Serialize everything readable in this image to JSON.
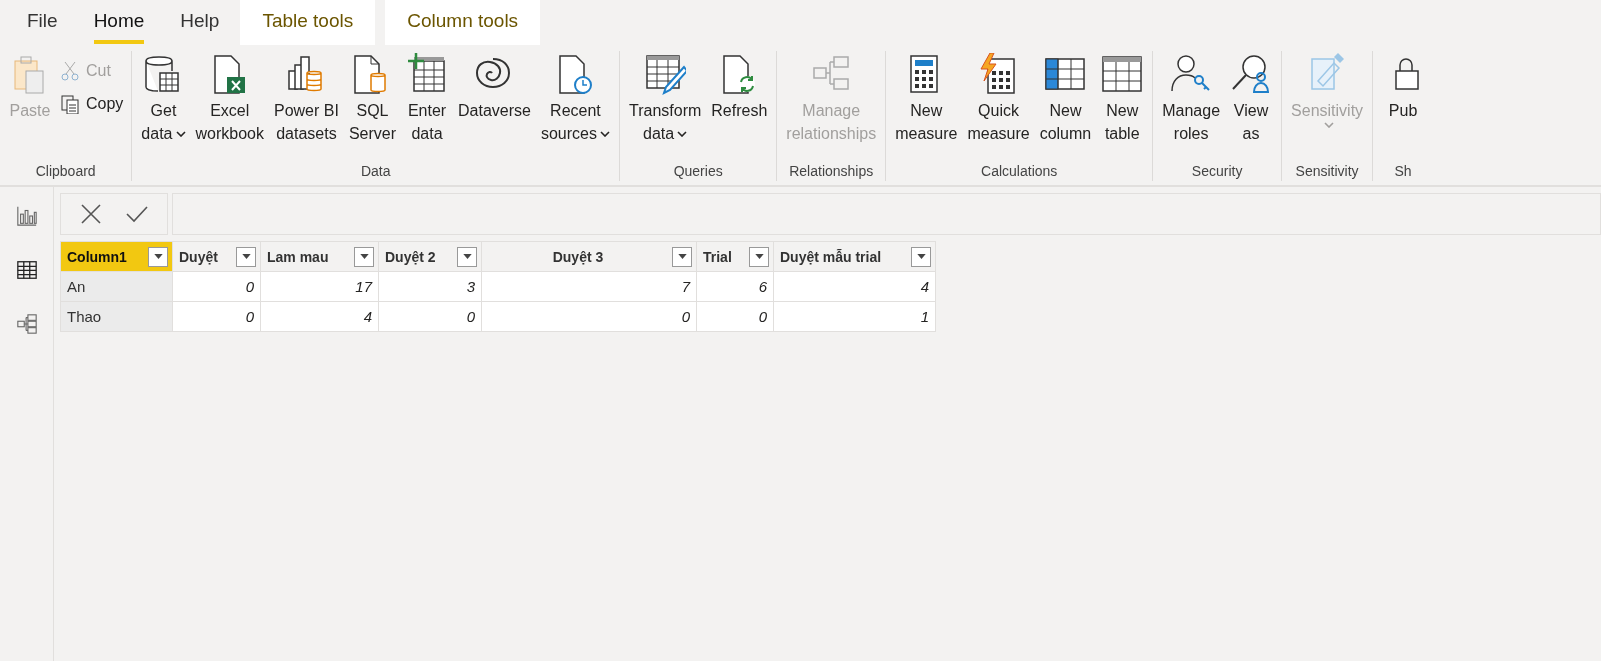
{
  "menu_tabs": [
    {
      "label": "File",
      "selected": false,
      "kind": "plain"
    },
    {
      "label": "Home",
      "selected": true,
      "kind": "plain"
    },
    {
      "label": "Help",
      "selected": false,
      "kind": "plain"
    },
    {
      "label": "Table tools",
      "selected": false,
      "kind": "contextual"
    },
    {
      "label": "Column tools",
      "selected": false,
      "kind": "contextual"
    }
  ],
  "ribbon_groups": [
    {
      "label": "Clipboard",
      "buttons": [
        {
          "kind": "large",
          "lines": [
            "Paste"
          ],
          "disabled": true,
          "dropdown": false
        },
        {
          "kind": "small",
          "lines": [
            "Cut"
          ],
          "disabled": true,
          "dropdown": false
        },
        {
          "kind": "small",
          "lines": [
            "Copy"
          ],
          "disabled": false,
          "dropdown": false
        }
      ]
    },
    {
      "label": "Data",
      "buttons": [
        {
          "kind": "large",
          "lines": [
            "Get",
            "data"
          ],
          "disabled": false,
          "dropdown": true
        },
        {
          "kind": "large",
          "lines": [
            "Excel",
            "workbook"
          ],
          "disabled": false,
          "dropdown": false
        },
        {
          "kind": "large",
          "lines": [
            "Power BI",
            "datasets"
          ],
          "disabled": false,
          "dropdown": false
        },
        {
          "kind": "large",
          "lines": [
            "SQL",
            "Server"
          ],
          "disabled": false,
          "dropdown": false
        },
        {
          "kind": "large",
          "lines": [
            "Enter",
            "data"
          ],
          "disabled": false,
          "dropdown": false
        },
        {
          "kind": "large",
          "lines": [
            "Dataverse"
          ],
          "disabled": false,
          "dropdown": false
        },
        {
          "kind": "large",
          "lines": [
            "Recent",
            "sources"
          ],
          "disabled": false,
          "dropdown": true
        }
      ]
    },
    {
      "label": "Queries",
      "buttons": [
        {
          "kind": "large",
          "lines": [
            "Transform",
            "data"
          ],
          "disabled": false,
          "dropdown": true
        },
        {
          "kind": "large",
          "lines": [
            "Refresh"
          ],
          "disabled": false,
          "dropdown": false
        }
      ]
    },
    {
      "label": "Relationships",
      "buttons": [
        {
          "kind": "large",
          "lines": [
            "Manage",
            "relationships"
          ],
          "disabled": true,
          "dropdown": false
        }
      ]
    },
    {
      "label": "Calculations",
      "buttons": [
        {
          "kind": "large",
          "lines": [
            "New",
            "measure"
          ],
          "disabled": false,
          "dropdown": false
        },
        {
          "kind": "large",
          "lines": [
            "Quick",
            "measure"
          ],
          "disabled": false,
          "dropdown": false
        },
        {
          "kind": "large",
          "lines": [
            "New",
            "column"
          ],
          "disabled": false,
          "dropdown": false
        },
        {
          "kind": "large",
          "lines": [
            "New",
            "table"
          ],
          "disabled": false,
          "dropdown": false
        }
      ]
    },
    {
      "label": "Security",
      "buttons": [
        {
          "kind": "large",
          "lines": [
            "Manage",
            "roles"
          ],
          "disabled": false,
          "dropdown": false
        },
        {
          "kind": "large",
          "lines": [
            "View",
            "as"
          ],
          "disabled": false,
          "dropdown": false
        }
      ]
    },
    {
      "label": "Sensitivity",
      "buttons": [
        {
          "kind": "large",
          "lines": [
            "Sensitivity"
          ],
          "disabled": true,
          "dropdown": true
        }
      ]
    },
    {
      "label": "Sh",
      "buttons": [
        {
          "kind": "large",
          "lines": [
            "Pub"
          ],
          "disabled": false,
          "dropdown": false
        }
      ]
    }
  ],
  "table": {
    "columns": [
      {
        "label": "Column1",
        "selected": true,
        "kind": "text"
      },
      {
        "label": "Duyệt",
        "selected": false,
        "kind": "number"
      },
      {
        "label": "Lam mau",
        "selected": false,
        "kind": "number"
      },
      {
        "label": "Duyệt 2",
        "selected": false,
        "kind": "number"
      },
      {
        "label": "Duyệt 3",
        "selected": false,
        "kind": "number"
      },
      {
        "label": "Trial",
        "selected": false,
        "kind": "number"
      },
      {
        "label": "Duyệt mẫu trial",
        "selected": false,
        "kind": "number"
      }
    ],
    "rows": [
      [
        "An",
        "0",
        "17",
        "3",
        "7",
        "6",
        "4"
      ],
      [
        "Thao",
        "0",
        "4",
        "0",
        "0",
        "0",
        "1"
      ]
    ]
  }
}
